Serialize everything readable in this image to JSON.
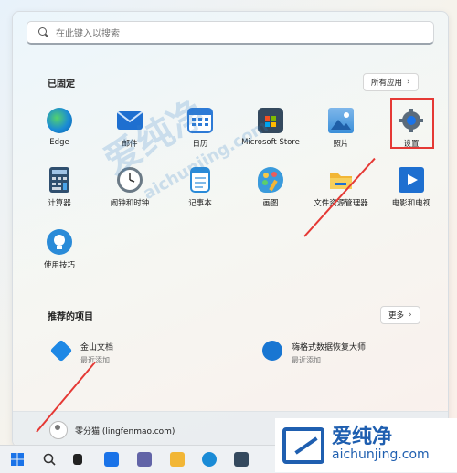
{
  "search": {
    "placeholder": "在此键入以搜索"
  },
  "pinned": {
    "title": "已固定",
    "all_apps_label": "所有应用",
    "row1": [
      {
        "label": "Edge",
        "icon": "edge-icon",
        "color": "#1a8bd6"
      },
      {
        "label": "邮件",
        "icon": "mail-icon",
        "color": "#1e6fd0"
      },
      {
        "label": "日历",
        "icon": "calendar-icon",
        "color": "#2d7ad6"
      },
      {
        "label": "Microsoft Store",
        "icon": "store-icon",
        "color": "#34495e"
      },
      {
        "label": "照片",
        "icon": "photos-icon",
        "color": "#3a8fd9"
      },
      {
        "label": "设置",
        "icon": "settings-gear-icon",
        "color": "#5a6b7b"
      }
    ],
    "row2": [
      {
        "label": "计算器",
        "icon": "calculator-icon",
        "color": "#2f4f6f"
      },
      {
        "label": "闹钟和时钟",
        "icon": "alarm-clock-icon",
        "color": "#6b7a86"
      },
      {
        "label": "记事本",
        "icon": "notepad-icon",
        "color": "#2a8bd8"
      },
      {
        "label": "画图",
        "icon": "paint-icon",
        "color": "#3a9bdc"
      },
      {
        "label": "文件资源管理器",
        "icon": "file-explorer-icon",
        "color": "#f2b636"
      },
      {
        "label": "电影和电视",
        "icon": "movies-tv-icon",
        "color": "#1e6fd0"
      }
    ],
    "row3": [
      {
        "label": "使用技巧",
        "icon": "tips-lightbulb-icon",
        "color": "#2a8bd8"
      }
    ]
  },
  "recommended": {
    "title": "推荐的项目",
    "more_label": "更多",
    "items": [
      {
        "name": "金山文档",
        "sub": "最近添加",
        "icon": "kingsoft-docs-icon",
        "color": "#1e88e5"
      },
      {
        "name": "嗨格式数据恢复大师",
        "sub": "最近添加",
        "icon": "data-recovery-icon",
        "color": "#1976d2"
      }
    ]
  },
  "user": {
    "name": "零分猫 (lingfenmao.com)"
  },
  "watermark": {
    "cn": "爱纯净",
    "en": "aichunjing.com"
  },
  "colors": {
    "highlight": "#e53935",
    "accent": "#1a73e8"
  }
}
